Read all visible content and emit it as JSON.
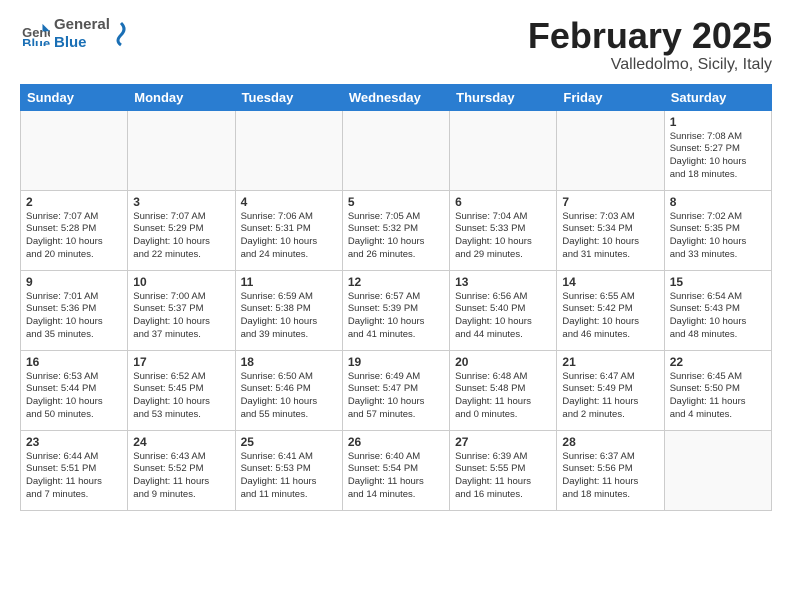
{
  "logo": {
    "general": "General",
    "blue": "Blue"
  },
  "title": "February 2025",
  "location": "Valledolmo, Sicily, Italy",
  "days_of_week": [
    "Sunday",
    "Monday",
    "Tuesday",
    "Wednesday",
    "Thursday",
    "Friday",
    "Saturday"
  ],
  "weeks": [
    [
      {
        "day": "",
        "text": ""
      },
      {
        "day": "",
        "text": ""
      },
      {
        "day": "",
        "text": ""
      },
      {
        "day": "",
        "text": ""
      },
      {
        "day": "",
        "text": ""
      },
      {
        "day": "",
        "text": ""
      },
      {
        "day": "1",
        "text": "Sunrise: 7:08 AM\nSunset: 5:27 PM\nDaylight: 10 hours\nand 18 minutes."
      }
    ],
    [
      {
        "day": "2",
        "text": "Sunrise: 7:07 AM\nSunset: 5:28 PM\nDaylight: 10 hours\nand 20 minutes."
      },
      {
        "day": "3",
        "text": "Sunrise: 7:07 AM\nSunset: 5:29 PM\nDaylight: 10 hours\nand 22 minutes."
      },
      {
        "day": "4",
        "text": "Sunrise: 7:06 AM\nSunset: 5:31 PM\nDaylight: 10 hours\nand 24 minutes."
      },
      {
        "day": "5",
        "text": "Sunrise: 7:05 AM\nSunset: 5:32 PM\nDaylight: 10 hours\nand 26 minutes."
      },
      {
        "day": "6",
        "text": "Sunrise: 7:04 AM\nSunset: 5:33 PM\nDaylight: 10 hours\nand 29 minutes."
      },
      {
        "day": "7",
        "text": "Sunrise: 7:03 AM\nSunset: 5:34 PM\nDaylight: 10 hours\nand 31 minutes."
      },
      {
        "day": "8",
        "text": "Sunrise: 7:02 AM\nSunset: 5:35 PM\nDaylight: 10 hours\nand 33 minutes."
      }
    ],
    [
      {
        "day": "9",
        "text": "Sunrise: 7:01 AM\nSunset: 5:36 PM\nDaylight: 10 hours\nand 35 minutes."
      },
      {
        "day": "10",
        "text": "Sunrise: 7:00 AM\nSunset: 5:37 PM\nDaylight: 10 hours\nand 37 minutes."
      },
      {
        "day": "11",
        "text": "Sunrise: 6:59 AM\nSunset: 5:38 PM\nDaylight: 10 hours\nand 39 minutes."
      },
      {
        "day": "12",
        "text": "Sunrise: 6:57 AM\nSunset: 5:39 PM\nDaylight: 10 hours\nand 41 minutes."
      },
      {
        "day": "13",
        "text": "Sunrise: 6:56 AM\nSunset: 5:40 PM\nDaylight: 10 hours\nand 44 minutes."
      },
      {
        "day": "14",
        "text": "Sunrise: 6:55 AM\nSunset: 5:42 PM\nDaylight: 10 hours\nand 46 minutes."
      },
      {
        "day": "15",
        "text": "Sunrise: 6:54 AM\nSunset: 5:43 PM\nDaylight: 10 hours\nand 48 minutes."
      }
    ],
    [
      {
        "day": "16",
        "text": "Sunrise: 6:53 AM\nSunset: 5:44 PM\nDaylight: 10 hours\nand 50 minutes."
      },
      {
        "day": "17",
        "text": "Sunrise: 6:52 AM\nSunset: 5:45 PM\nDaylight: 10 hours\nand 53 minutes."
      },
      {
        "day": "18",
        "text": "Sunrise: 6:50 AM\nSunset: 5:46 PM\nDaylight: 10 hours\nand 55 minutes."
      },
      {
        "day": "19",
        "text": "Sunrise: 6:49 AM\nSunset: 5:47 PM\nDaylight: 10 hours\nand 57 minutes."
      },
      {
        "day": "20",
        "text": "Sunrise: 6:48 AM\nSunset: 5:48 PM\nDaylight: 11 hours\nand 0 minutes."
      },
      {
        "day": "21",
        "text": "Sunrise: 6:47 AM\nSunset: 5:49 PM\nDaylight: 11 hours\nand 2 minutes."
      },
      {
        "day": "22",
        "text": "Sunrise: 6:45 AM\nSunset: 5:50 PM\nDaylight: 11 hours\nand 4 minutes."
      }
    ],
    [
      {
        "day": "23",
        "text": "Sunrise: 6:44 AM\nSunset: 5:51 PM\nDaylight: 11 hours\nand 7 minutes."
      },
      {
        "day": "24",
        "text": "Sunrise: 6:43 AM\nSunset: 5:52 PM\nDaylight: 11 hours\nand 9 minutes."
      },
      {
        "day": "25",
        "text": "Sunrise: 6:41 AM\nSunset: 5:53 PM\nDaylight: 11 hours\nand 11 minutes."
      },
      {
        "day": "26",
        "text": "Sunrise: 6:40 AM\nSunset: 5:54 PM\nDaylight: 11 hours\nand 14 minutes."
      },
      {
        "day": "27",
        "text": "Sunrise: 6:39 AM\nSunset: 5:55 PM\nDaylight: 11 hours\nand 16 minutes."
      },
      {
        "day": "28",
        "text": "Sunrise: 6:37 AM\nSunset: 5:56 PM\nDaylight: 11 hours\nand 18 minutes."
      },
      {
        "day": "",
        "text": ""
      }
    ]
  ]
}
